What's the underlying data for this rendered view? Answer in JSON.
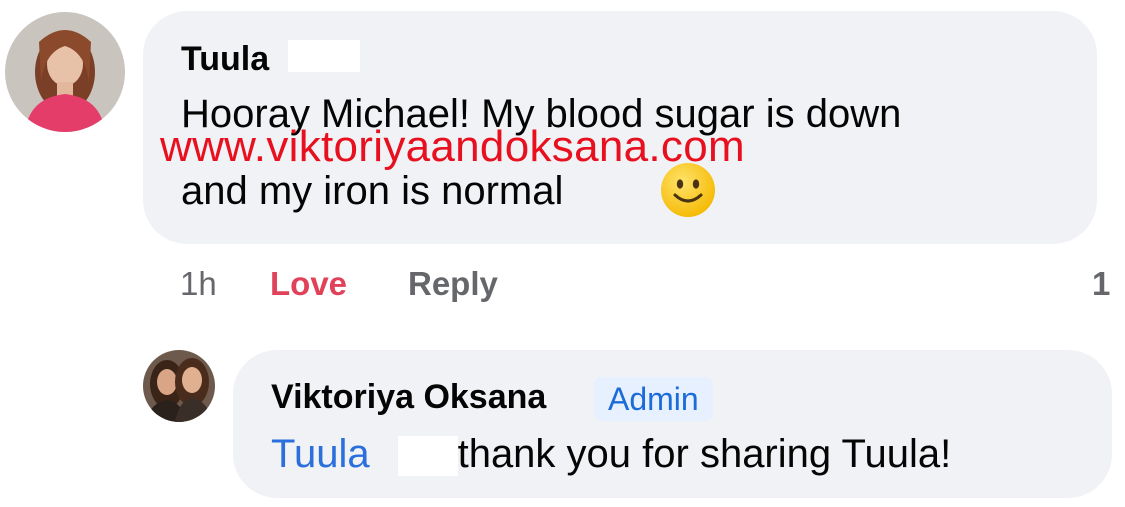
{
  "comment": {
    "author": "Tuula",
    "text_line1": "Hooray Michael! My blood sugar is down",
    "text_line2": "and my iron is normal",
    "emoji": "slightly-smiling-face-icon",
    "watermark": "www.viktoriyaandoksana.com",
    "time": "1h",
    "love_label": "Love",
    "reply_label": "Reply",
    "reaction_count": "1"
  },
  "reply": {
    "author": "Viktoriya Oksana",
    "badge": "Admin",
    "mention": "Tuula",
    "text": "thank you for sharing Tuula!"
  },
  "colors": {
    "bubble": "#f0f2f5",
    "love": "#e0425a",
    "link": "#2a6fdb",
    "watermark": "#e8101e",
    "meta": "#65676b"
  }
}
